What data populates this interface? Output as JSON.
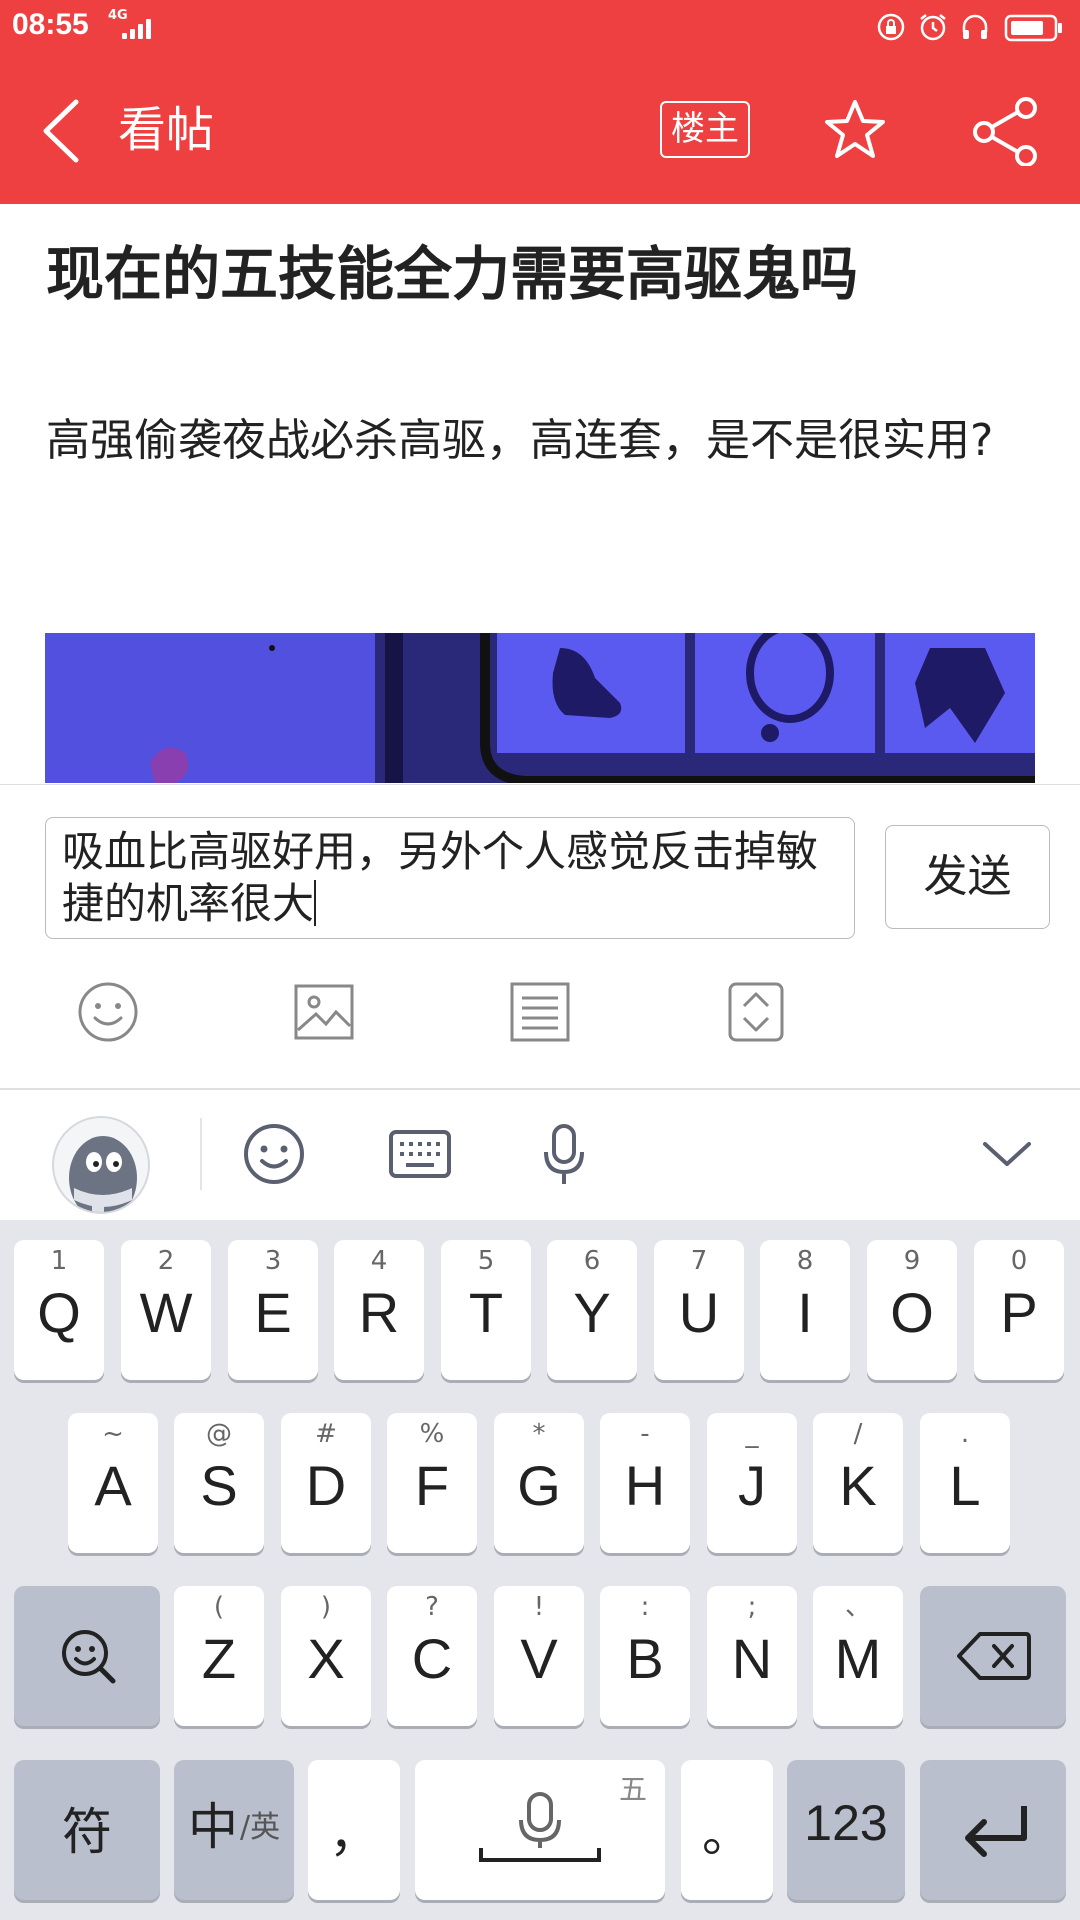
{
  "status_bar": {
    "time": "08:55",
    "network": "4G"
  },
  "header": {
    "title": "看帖",
    "op_label": "楼主"
  },
  "post": {
    "title": "现在的五技能全力需要高驱鬼吗",
    "body": "高强偷袭夜战必杀高驱，高连套，是不是很实用?"
  },
  "reply": {
    "text": "吸血比高驱好用，另外个人感觉反击掉敏捷的机率很大",
    "send_label": "发送"
  },
  "toolbar": {
    "icons": [
      "emoji-icon",
      "image-icon",
      "list-icon",
      "expand-icon"
    ]
  },
  "keyboard": {
    "row1": [
      {
        "main": "Q",
        "sub": "1"
      },
      {
        "main": "W",
        "sub": "2"
      },
      {
        "main": "E",
        "sub": "3"
      },
      {
        "main": "R",
        "sub": "4"
      },
      {
        "main": "T",
        "sub": "5"
      },
      {
        "main": "Y",
        "sub": "6"
      },
      {
        "main": "U",
        "sub": "7"
      },
      {
        "main": "I",
        "sub": "8"
      },
      {
        "main": "O",
        "sub": "9"
      },
      {
        "main": "P",
        "sub": "0"
      }
    ],
    "row2": [
      {
        "main": "A",
        "sub": "~"
      },
      {
        "main": "S",
        "sub": "@"
      },
      {
        "main": "D",
        "sub": "#"
      },
      {
        "main": "F",
        "sub": "%"
      },
      {
        "main": "G",
        "sub": "*"
      },
      {
        "main": "H",
        "sub": "-"
      },
      {
        "main": "J",
        "sub": "_"
      },
      {
        "main": "K",
        "sub": "/"
      },
      {
        "main": "L",
        "sub": "."
      }
    ],
    "row3": [
      {
        "main": "Z",
        "sub": "("
      },
      {
        "main": "X",
        "sub": ")"
      },
      {
        "main": "C",
        "sub": "?"
      },
      {
        "main": "V",
        "sub": "!"
      },
      {
        "main": "B",
        "sub": ":"
      },
      {
        "main": "N",
        "sub": ";"
      },
      {
        "main": "M",
        "sub": "、"
      }
    ],
    "symbols_label": "符",
    "lang_main": "中",
    "lang_sub": "/英",
    "comma": "，",
    "space_hint": "五",
    "period": "。",
    "num_label": "123"
  },
  "colors": {
    "brand": "#ee4040",
    "keyboard_bg": "#e4e6ec",
    "function_key": "#b9bfcc"
  }
}
